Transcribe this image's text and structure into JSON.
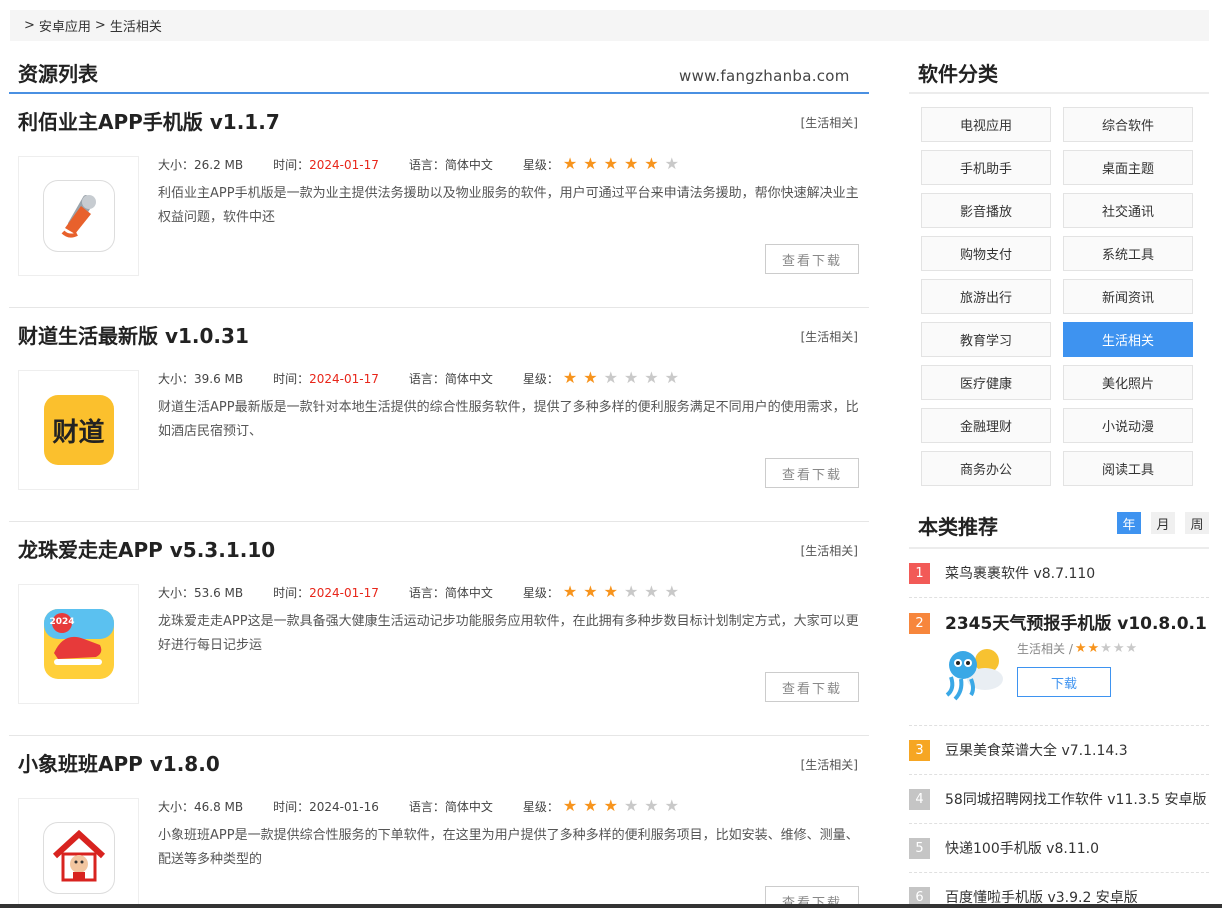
{
  "breadcrumb": {
    "sep1": ">",
    "item1": "安卓应用",
    "sep2": ">",
    "item2": "生活相关"
  },
  "list": {
    "title": "资源列表",
    "site": "www.fangzhanba.com",
    "download_label": "查看下载",
    "labels": {
      "size": "大小：",
      "time": "时间：",
      "lang": "语言：",
      "rating": "星级："
    },
    "items": [
      {
        "name": "利佰业主APP手机版 v1.1.7",
        "category": "[生活相关]",
        "size": "26.2 MB",
        "date": "2024-01-17",
        "date_highlight": true,
        "language": "简体中文",
        "rating": 5,
        "desc": "利佰业主APP手机版是一款为业主提供法务援助以及物业服务的软件，用户可通过平台来申请法务援助，帮你快速解决业主权益问题，软件中还",
        "icon": "megaphone-icon"
      },
      {
        "name": "财道生活最新版 v1.0.31",
        "category": "[生活相关]",
        "size": "39.6 MB",
        "date": "2024-01-17",
        "date_highlight": true,
        "language": "简体中文",
        "rating": 2,
        "desc": "财道生活APP最新版是一款针对本地生活提供的综合性服务软件，提供了多种多样的便利服务满足不同用户的使用需求，比如酒店民宿预订、",
        "icon": "caidao-logo-icon",
        "icon_text": "财道"
      },
      {
        "name": "龙珠爱走走APP v5.3.1.10",
        "category": "[生活相关]",
        "size": "53.6 MB",
        "date": "2024-01-17",
        "date_highlight": true,
        "language": "简体中文",
        "rating": 3,
        "desc": "龙珠爱走走APP这是一款具备强大健康生活运动记步功能服务应用软件，在此拥有多种步数目标计划制定方式，大家可以更好进行每日记步运",
        "icon": "sneaker-icon",
        "icon_text": "2024"
      },
      {
        "name": "小象班班APP v1.8.0",
        "category": "[生活相关]",
        "size": "46.8 MB",
        "date": "2024-01-16",
        "date_highlight": false,
        "language": "简体中文",
        "rating": 3,
        "desc": "小象班班APP是一款提供综合性服务的下单软件，在这里为用户提供了多种多样的便利服务项目，比如安装、维修、测量、配送等多种类型的",
        "icon": "house-mascot-icon"
      }
    ]
  },
  "categories": {
    "title": "软件分类",
    "active": "生活相关",
    "items": [
      "电视应用",
      "综合软件",
      "手机助手",
      "桌面主题",
      "影音播放",
      "社交通讯",
      "购物支付",
      "系统工具",
      "旅游出行",
      "新闻资讯",
      "教育学习",
      "生活相关",
      "医疗健康",
      "美化照片",
      "金融理财",
      "小说动漫",
      "商务办公",
      "阅读工具"
    ]
  },
  "recommend": {
    "title": "本类推荐",
    "tabs": [
      "年",
      "月",
      "周"
    ],
    "active_tab": "年",
    "featured": {
      "rank": "2",
      "name": "2345天气预报手机版 v10.8.0.1",
      "category": "生活相关 /",
      "rating": 2,
      "download": "下载",
      "icon": "weather-mascot-icon"
    },
    "items": [
      {
        "rank": "1",
        "name": "菜鸟裹裹软件 v8.7.110"
      },
      {
        "rank": "3",
        "name": "豆果美食菜谱大全 v7.1.14.3"
      },
      {
        "rank": "4",
        "name": "58同城招聘网找工作软件 v11.3.5 安卓版"
      },
      {
        "rank": "5",
        "name": "快递100手机版 v8.11.0"
      },
      {
        "rank": "6",
        "name": "百度懂啦手机版 v3.9.2 安卓版"
      }
    ]
  },
  "colors": {
    "accent": "#3e93f0",
    "star_on": "#f7941d",
    "star_off": "#c9c9c9",
    "date_red": "#e8261a"
  }
}
